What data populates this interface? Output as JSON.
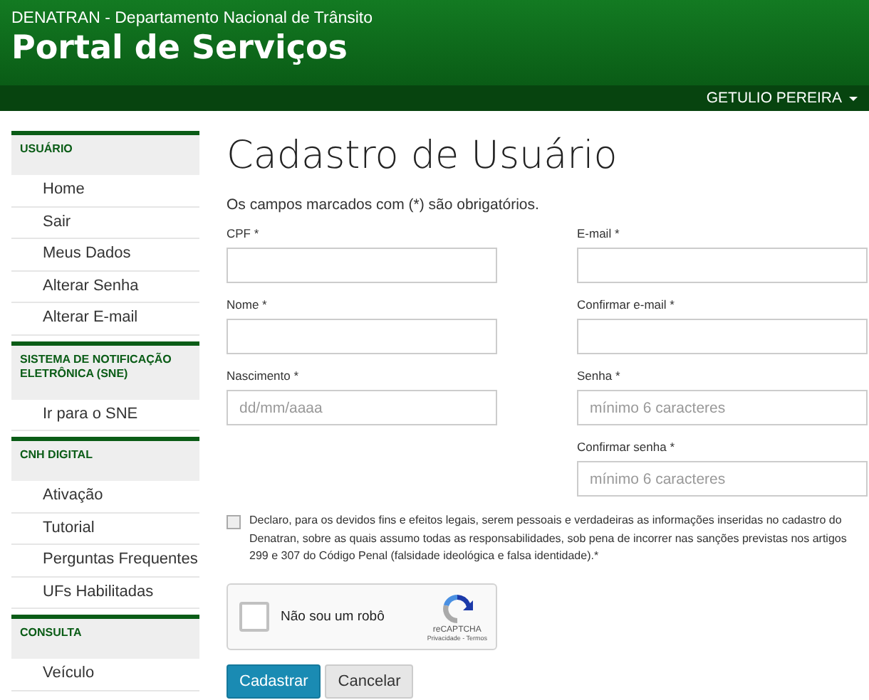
{
  "header": {
    "org": "DENATRAN - Departamento Nacional de Trânsito",
    "title": "Portal de Serviços",
    "user": "GETULIO PEREIRA"
  },
  "sidebar": [
    {
      "title": "USUÁRIO",
      "items": [
        "Home",
        "Sair",
        "Meus Dados",
        "Alterar Senha",
        "Alterar E-mail"
      ]
    },
    {
      "title": "SISTEMA DE NOTIFICAÇÃO ELETRÔNICA (SNE)",
      "items": [
        "Ir para o SNE"
      ]
    },
    {
      "title": "CNH DIGITAL",
      "items": [
        "Ativação",
        "Tutorial",
        "Perguntas Frequentes",
        "UFs Habilitadas"
      ]
    },
    {
      "title": "CONSULTA",
      "items": [
        "Veículo"
      ]
    }
  ],
  "page_title": "Cadastro de Usuário",
  "required_note": "Os campos marcados com (*) são obrigatórios.",
  "form_rows": [
    {
      "left": {
        "label": "CPF *"
      },
      "right": {
        "label": "E-mail *"
      }
    },
    {
      "left": {
        "label": "Nome *"
      },
      "right": {
        "label": "Confirmar e-mail *"
      }
    },
    {
      "left": {
        "label": "Nascimento *",
        "placeholder": "dd/mm/aaaa"
      },
      "right": {
        "label": "Senha *",
        "placeholder": "mínimo 6 caracteres"
      }
    },
    {
      "right": {
        "label": "Confirmar senha *",
        "placeholder": "mínimo 6 caracteres"
      }
    }
  ],
  "declaration": {
    "checked": false,
    "text": "Declaro, para os devidos fins e efeitos legais, serem pessoais e verdadeiras as informações inseridas no cadastro do Denatran, sobre as quais assumo todas as responsabilidades, sob pena de incorrer nas sanções previstas nos artigos 299 e 307 do Código Penal (falsidade ideológica e falsa identidade).*"
  },
  "captcha": {
    "checked": false,
    "label": "Não sou um robô",
    "brand": "reCAPTCHA",
    "links": "Privacidade - Termos"
  },
  "buttons": [
    {
      "label": "Cadastrar",
      "kind": "primary"
    },
    {
      "label": "Cancelar",
      "kind": "default"
    }
  ]
}
